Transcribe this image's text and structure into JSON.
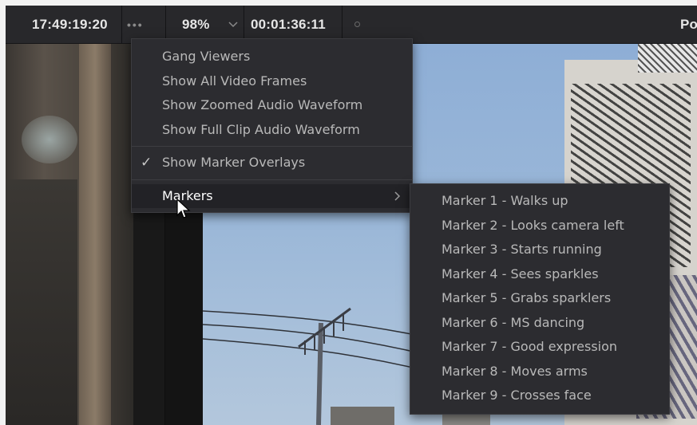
{
  "toolbar": {
    "source_timecode": "17:49:19:20",
    "options_dots": "•••",
    "zoom_level": "98%",
    "duration_timecode": "00:01:36:11",
    "right_label": "Po"
  },
  "options_menu": {
    "items": [
      {
        "label": "Gang Viewers",
        "checked": false
      },
      {
        "label": "Show All Video Frames",
        "checked": false
      },
      {
        "label": "Show Zoomed Audio Waveform",
        "checked": false
      },
      {
        "label": "Show Full Clip Audio Waveform",
        "checked": false
      }
    ],
    "marker_overlays": {
      "label": "Show Marker Overlays",
      "checked": true,
      "check_glyph": "✓"
    },
    "markers": {
      "label": "Markers",
      "has_submenu": true,
      "highlighted": true
    }
  },
  "markers_submenu": {
    "items": [
      "Marker 1 - Walks up",
      "Marker 2 - Looks camera left",
      "Marker 3 - Starts running",
      "Marker 4 - Sees sparkles",
      "Marker 5 - Grabs sparklers",
      "Marker 6 - MS dancing",
      "Marker 7 - Good expression",
      "Marker 8 - Moves arms",
      "Marker 9 - Crosses face"
    ]
  },
  "colors": {
    "toolbar_bg": "#28282b",
    "menu_bg": "#2c2c30",
    "menu_text": "#b9b9b9",
    "highlight_text": "#ffffff"
  }
}
